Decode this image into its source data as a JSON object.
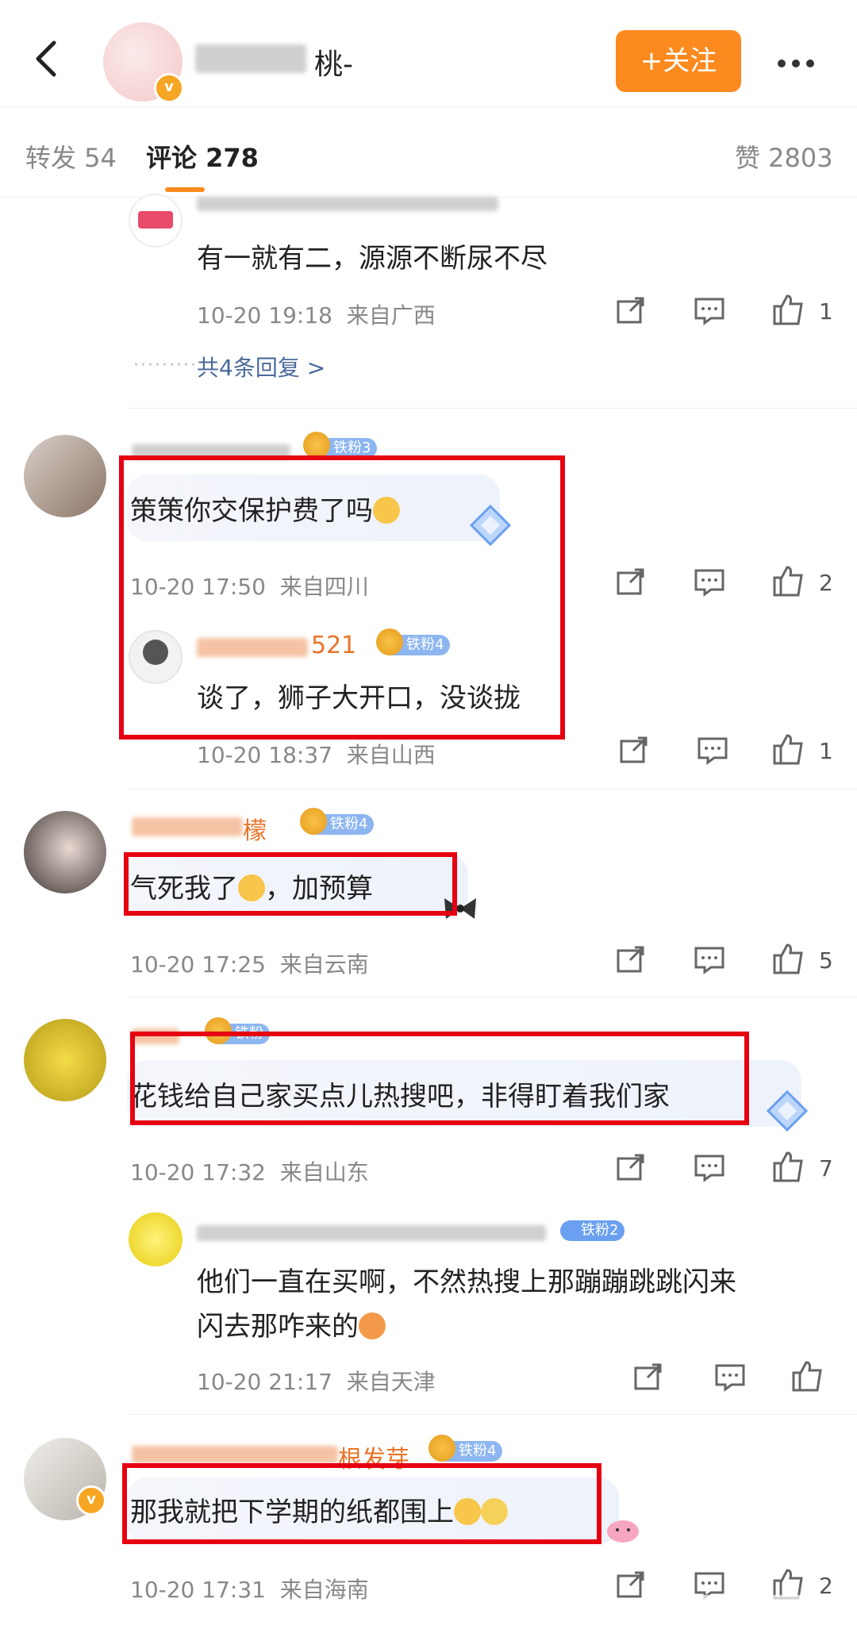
{
  "header": {
    "back_icon": "back-arrow-icon",
    "blog_name_visible": "桃-",
    "verified_icon": "v",
    "follow_label": "+关注",
    "more_icon": "more-dots-icon"
  },
  "tabs": {
    "repost": "转发 54",
    "comment": "评论 278",
    "like": "赞 2803"
  },
  "comments": [
    {
      "text": "有一就有二，源源不断尿不尽",
      "time": "10-20 19:18",
      "location": "来自广西",
      "likes": "1",
      "replies_link": "共4条回复"
    },
    {
      "badge": "铁粉3",
      "text": "策策你交保护费了吗",
      "time": "10-20 17:50",
      "location": "来自四川",
      "likes": "2",
      "reply": {
        "name": "521",
        "badge": "铁粉4",
        "text": "谈了，狮子大开口，没谈拢",
        "time": "10-20 18:37",
        "location": "来自山西",
        "likes": "1"
      }
    },
    {
      "name": "檬",
      "badge": "铁粉4",
      "text": "气死我了",
      "text_suffix": "，加预算",
      "time": "10-20 17:25",
      "location": "来自云南",
      "likes": "5"
    },
    {
      "text": "花钱给自己家买点儿热搜吧，非得盯着我们家",
      "time": "10-20 17:32",
      "location": "来自山东",
      "likes": "7",
      "reply": {
        "badge": "铁粉2",
        "text_line1": "他们一直在买啊，不然热搜上那蹦蹦跳跳闪来",
        "text_line2": "闪去那咋来的",
        "time": "10-20 21:17",
        "location": "来自天津"
      }
    },
    {
      "name": "根发芽",
      "badge": "铁粉4",
      "text": "那我就把下学期的纸都围上",
      "time": "10-20 17:31",
      "location": "来自海南",
      "likes": "2"
    }
  ],
  "colors": {
    "accent": "#fd8a1e",
    "highlight_box": "#e60012",
    "username": "#e8742a",
    "link": "#4a6a9a"
  }
}
